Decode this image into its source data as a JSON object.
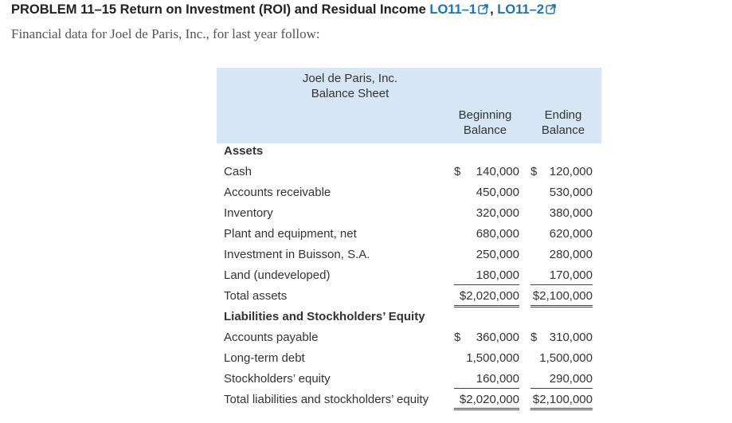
{
  "problem": {
    "title": "PROBLEM 11–15 Return on Investment (ROI) and Residual Income",
    "lo1": "LO11–1",
    "separator": ",",
    "lo2": "LO11–2",
    "intro": "Financial data for Joel de Paris, Inc., for last year follow:"
  },
  "sheet": {
    "company": "Joel de Paris, Inc.",
    "title": "Balance Sheet",
    "col_beginning": [
      "Beginning",
      "Balance"
    ],
    "col_ending": [
      "Ending",
      "Balance"
    ],
    "currency": "$",
    "assets_header": "Assets",
    "assets": [
      {
        "label": "Cash",
        "beginning": "140,000",
        "ending": "120,000"
      },
      {
        "label": "Accounts receivable",
        "beginning": "450,000",
        "ending": "530,000"
      },
      {
        "label": "Inventory",
        "beginning": "320,000",
        "ending": "380,000"
      },
      {
        "label": "Plant and equipment, net",
        "beginning": "680,000",
        "ending": "620,000"
      },
      {
        "label": "Investment in Buisson, S.A.",
        "beginning": "250,000",
        "ending": "280,000"
      },
      {
        "label": "Land (undeveloped)",
        "beginning": "180,000",
        "ending": "170,000"
      }
    ],
    "total_assets": {
      "label": "Total assets",
      "beginning": "$2,020,000",
      "ending": "$2,100,000"
    },
    "liabilities_header": "Liabilities and Stockholders’ Equity",
    "liabilities": [
      {
        "label": "Accounts payable",
        "beginning": "360,000",
        "ending": "310,000"
      },
      {
        "label": "Long-term debt",
        "beginning": "1,500,000",
        "ending": "1,500,000"
      },
      {
        "label": "Stockholders’ equity",
        "beginning": "160,000",
        "ending": "290,000"
      }
    ],
    "total_liabilities": {
      "label": "Total liabilities and stockholders’ equity",
      "beginning": "$2,020,000",
      "ending": "$2,100,000"
    }
  }
}
